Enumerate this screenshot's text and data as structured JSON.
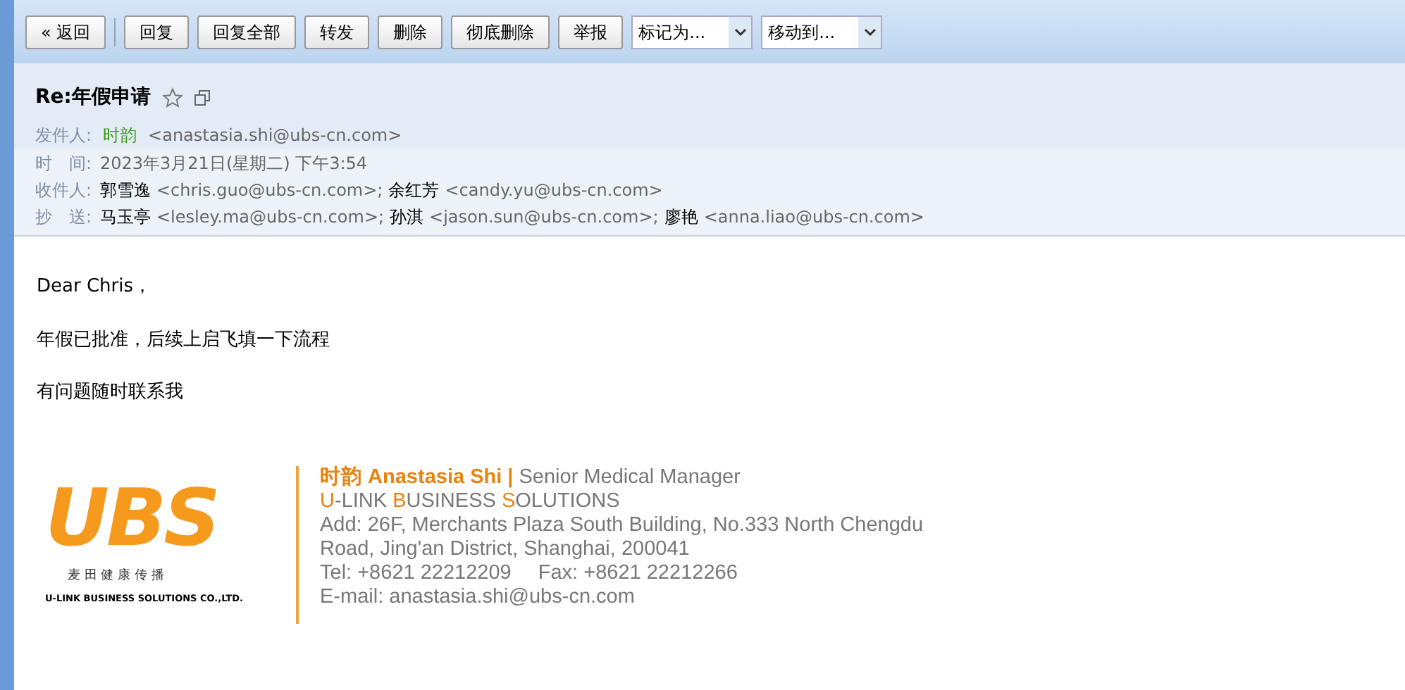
{
  "toolbar": {
    "buttons": [
      {
        "label": "« 返回",
        "kind": "back"
      },
      {
        "label": "回复",
        "kind": "action"
      },
      {
        "label": "回复全部",
        "kind": "action"
      },
      {
        "label": "转发",
        "kind": "action"
      },
      {
        "label": "删除",
        "kind": "action"
      },
      {
        "label": "彻底删除",
        "kind": "action"
      },
      {
        "label": "举报",
        "kind": "action"
      }
    ],
    "selects": [
      {
        "label": "标记为..."
      },
      {
        "label": "移动到..."
      }
    ]
  },
  "mail": {
    "subject": "Re:年假申请",
    "starred": false,
    "sender": {
      "label": "发件人:",
      "name": "时韵",
      "address": "<anastasia.shi@ubs-cn.com>"
    },
    "time": {
      "label": "时　间:",
      "value": "2023年3月21日(星期二) 下午3:54"
    },
    "to": {
      "label": "收件人:",
      "people": [
        {
          "name": "郭雪逸",
          "address": "<chris.guo@ubs-cn.com>;"
        },
        {
          "name": "余红芳",
          "address": "<candy.yu@ubs-cn.com>"
        }
      ]
    },
    "cc": {
      "label": "抄　送:",
      "people": [
        {
          "name": "马玉亭",
          "address": "<lesley.ma@ubs-cn.com>;"
        },
        {
          "name": "孙淇",
          "address": "<jason.sun@ubs-cn.com>;"
        },
        {
          "name": "廖艳",
          "address": "<anna.liao@ubs-cn.com>"
        }
      ]
    }
  },
  "body": [
    "Dear Chris，",
    "年假已批准，后续上启飞填一下流程",
    "有问题随时联系我"
  ],
  "signature": {
    "logo": {
      "letters": "UBS",
      "chinese": "麦 田 健 康 传 播",
      "english": "U-LINK BUSINESS SOLUTIONS CO.,LTD."
    },
    "name": "时韵 Anastasia Shi |",
    "title": "Senior Medical Manager",
    "company": [
      {
        "initial": "U",
        "rest": "-LINK"
      },
      {
        "initial": "B",
        "rest": "USINESS"
      },
      {
        "initial": "S",
        "rest": "OLUTIONS"
      }
    ],
    "lines": [
      "Add: 26F, Merchants Plaza South Building, No.333 North Chengdu",
      "Road, Jing'an District, Shanghai, 200041",
      "Tel: +8621 22212209　 Fax: +8621 22212266",
      "E-mail: anastasia.shi@ubs-cn.com"
    ]
  }
}
